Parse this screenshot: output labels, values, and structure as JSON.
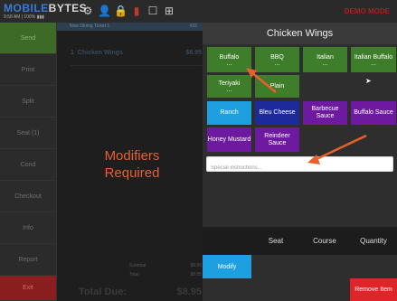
{
  "topbar": {
    "logo_part1": "MOBILE",
    "logo_part2": "BYTES",
    "status": "9:58 AM | 100% ▮▮▮",
    "demo": "DEMO MODE"
  },
  "leftmenu": {
    "items": [
      "Send",
      "Print",
      "Split",
      "Seat (1)",
      "Cond",
      "Checkout",
      "Info",
      "Report",
      "Exit"
    ]
  },
  "order": {
    "tab_label": "New Dining Ticket 1",
    "tab_count": "#32",
    "items": [
      {
        "qty": "1",
        "name": "Chicken Wings",
        "price": "$8.95"
      }
    ],
    "modifiers_required": "Modifiers Required",
    "subtotal_label": "Subtotal",
    "subtotal_value": "$8.95",
    "total_label": "Total",
    "total_value": "$8.95",
    "total_due_label": "Total Due:",
    "total_due_value": "$8.95"
  },
  "modifiers": {
    "title": "Chicken Wings",
    "sauces_row1": [
      {
        "label": "Buffalo",
        "dots": "..."
      },
      {
        "label": "BBQ",
        "dots": "..."
      },
      {
        "label": "Italian",
        "dots": "..."
      },
      {
        "label": "Italian Buffalo",
        "dots": "..."
      }
    ],
    "sauces_row2": [
      {
        "label": "Teriyaki",
        "dots": "..."
      },
      {
        "label": "Plain",
        "dots": ""
      }
    ],
    "dressings_row1": [
      {
        "label": "Ranch"
      },
      {
        "label": "Bleu Cheese"
      },
      {
        "label": "Barbecue Sauce"
      },
      {
        "label": "Buffalo Sauce"
      }
    ],
    "dressings_row2": [
      {
        "label": "Honey Mustard"
      },
      {
        "label": "Reindeer Sauce"
      }
    ],
    "special_placeholder": "Special instructions..."
  },
  "bottom": {
    "seat": "Seat",
    "course": "Course",
    "quantity": "Quantity",
    "modify": "Modify",
    "remove": "Remove Item"
  },
  "colors": {
    "green": "#3e7d2a",
    "blue": "#1ea0e0",
    "navy": "#1d2a9a",
    "purple": "#6d1aa0",
    "red": "#e0252a",
    "accent_orange": "#e8602c"
  }
}
